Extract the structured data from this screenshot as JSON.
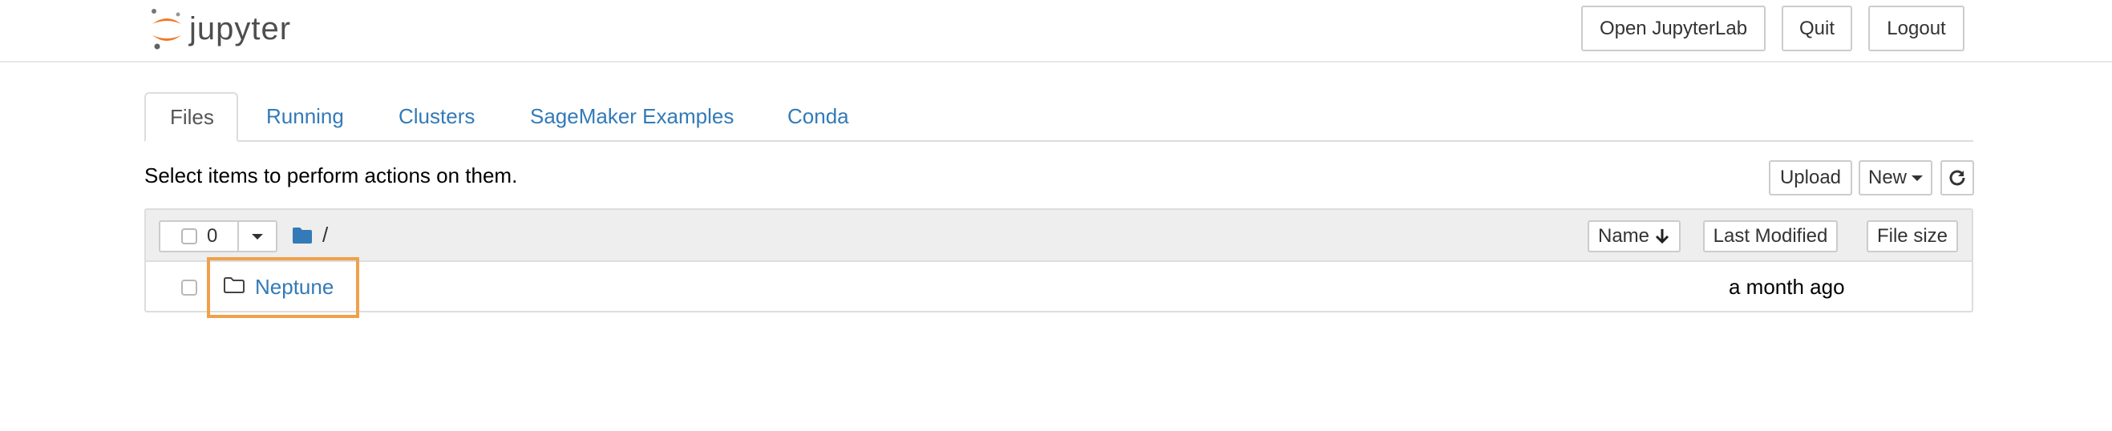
{
  "header": {
    "logo_text": "jupyter",
    "open_jupyterlab_label": "Open JupyterLab",
    "quit_label": "Quit",
    "logout_label": "Logout",
    "logo_color": "#F37726"
  },
  "tabs": [
    {
      "label": "Files",
      "active": true
    },
    {
      "label": "Running",
      "active": false
    },
    {
      "label": "Clusters",
      "active": false
    },
    {
      "label": "SageMaker Examples",
      "active": false
    },
    {
      "label": "Conda",
      "active": false
    }
  ],
  "toolbar": {
    "instructions": "Select items to perform actions on them.",
    "upload_label": "Upload",
    "new_label": "New",
    "refresh_icon": "refresh-icon"
  },
  "list_header": {
    "selected_count": "0",
    "breadcrumb": "/",
    "sort_name_label": "Name",
    "last_modified_label": "Last Modified",
    "file_size_label": "File size"
  },
  "items": [
    {
      "name": "Neptune",
      "type": "folder",
      "modified": "a month ago",
      "highlighted": true
    }
  ],
  "colors": {
    "link": "#337ab7",
    "highlight": "#F0A04B"
  }
}
